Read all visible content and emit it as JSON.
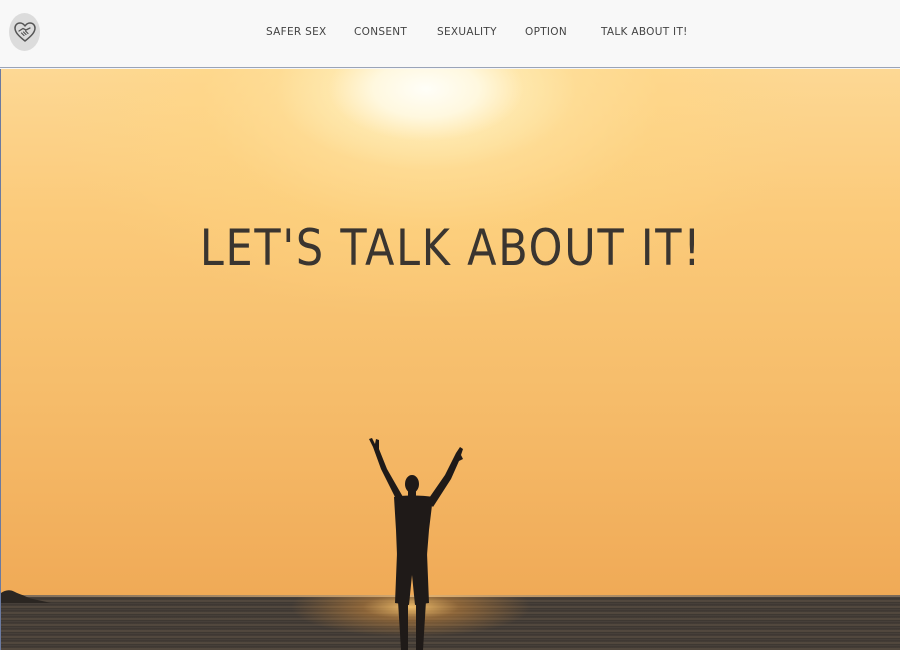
{
  "nav": {
    "items": [
      {
        "label": "SAFER SEX"
      },
      {
        "label": "CONSENT"
      },
      {
        "label": "SEXUALITY"
      },
      {
        "label": "OPTION"
      },
      {
        "label": "TALK ABOUT IT!"
      }
    ]
  },
  "hero": {
    "title": "LET'S TALK ABOUT IT!"
  },
  "icons": {
    "logo": "heart-handshake-icon"
  },
  "colors": {
    "nav_background": "#f8f8f8",
    "nav_text": "#444444",
    "hero_sky": "#f6bd6b",
    "hero_title": "#3a3530"
  }
}
